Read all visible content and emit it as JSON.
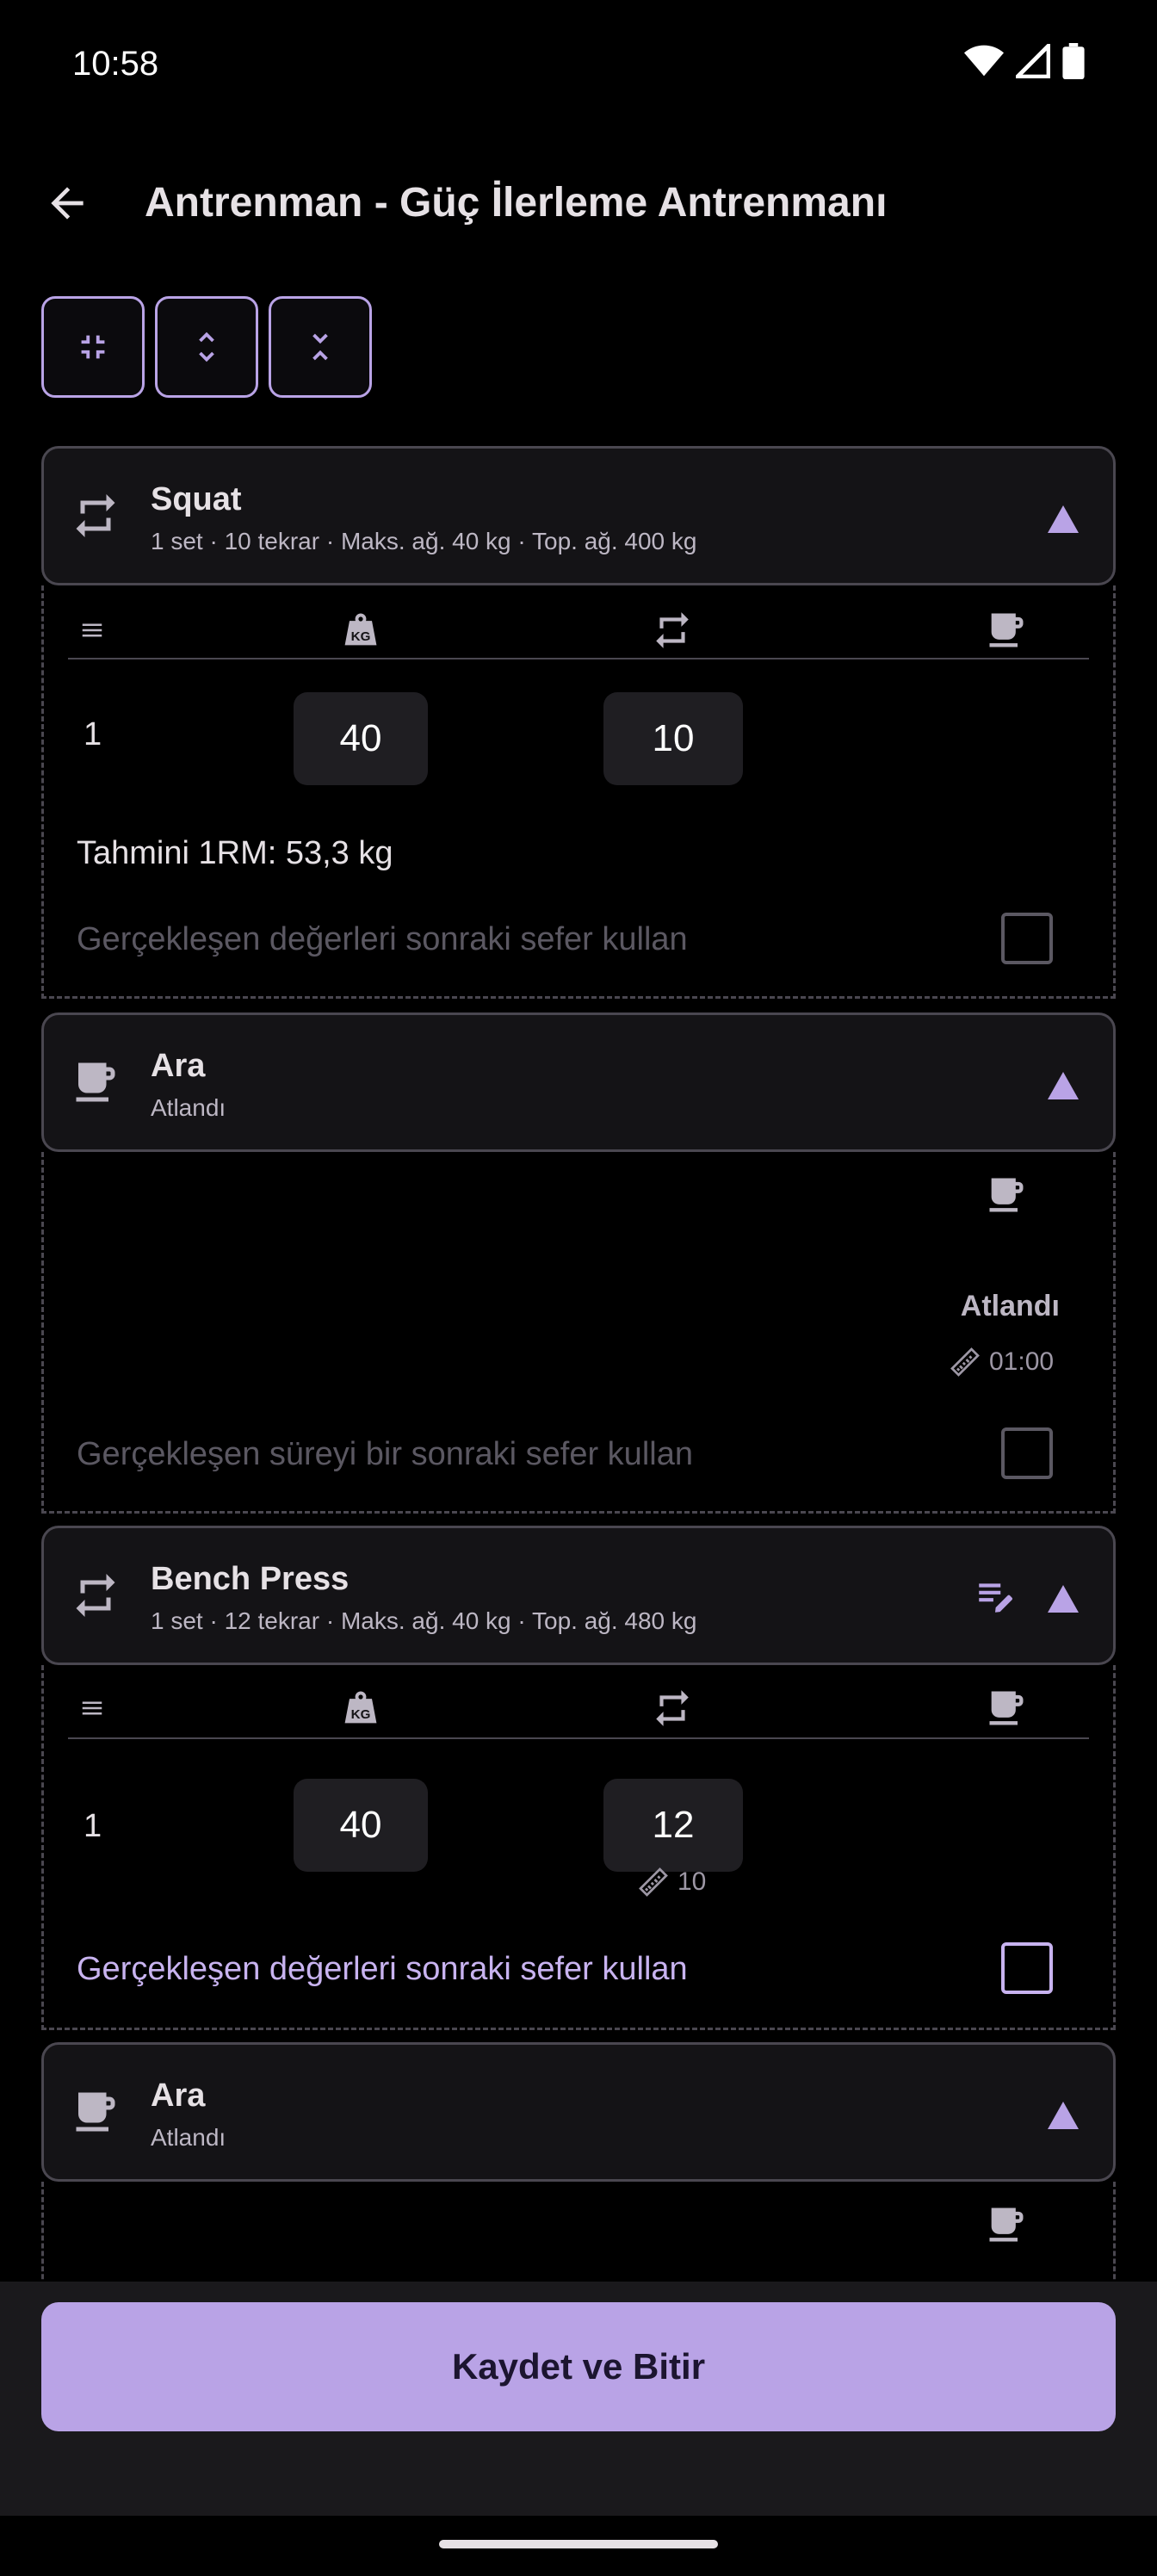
{
  "status": {
    "time": "10:58"
  },
  "header": {
    "title": "Antrenman - Güç İlerleme Antrenmanı"
  },
  "cards": [
    {
      "type": "exercise",
      "title": "Squat",
      "subtitle": "1 set · 10 tekrar · Maks. ağ. 40 kg · Top. ağ. 400 kg",
      "sets": [
        {
          "num": "1",
          "weight": "40",
          "reps": "10"
        }
      ],
      "estimate": "Tahmini 1RM: 53,3 kg",
      "pref_label": "Gerçekleşen değerleri sonraki sefer kullan"
    },
    {
      "type": "rest",
      "title": "Ara",
      "subtitle": "Atlandı",
      "status": "Atlandı",
      "duration": "01:00",
      "pref_label": "Gerçekleşen süreyi bir sonraki sefer kullan"
    },
    {
      "type": "exercise",
      "title": "Bench Press",
      "subtitle": "1 set · 12 tekrar · Maks. ağ. 40 kg · Top. ağ. 480 kg",
      "sets": [
        {
          "num": "1",
          "weight": "40",
          "reps": "12",
          "reps_target": "10"
        }
      ],
      "pref_label": "Gerçekleşen değerleri sonraki sefer kullan"
    },
    {
      "type": "rest",
      "title": "Ara",
      "subtitle": "Atlandı"
    }
  ],
  "actions": {
    "save_label": "Kaydet ve Bitir"
  },
  "colors": {
    "accent": "#b9a3e6",
    "background": "#000000",
    "card": "#141316"
  }
}
